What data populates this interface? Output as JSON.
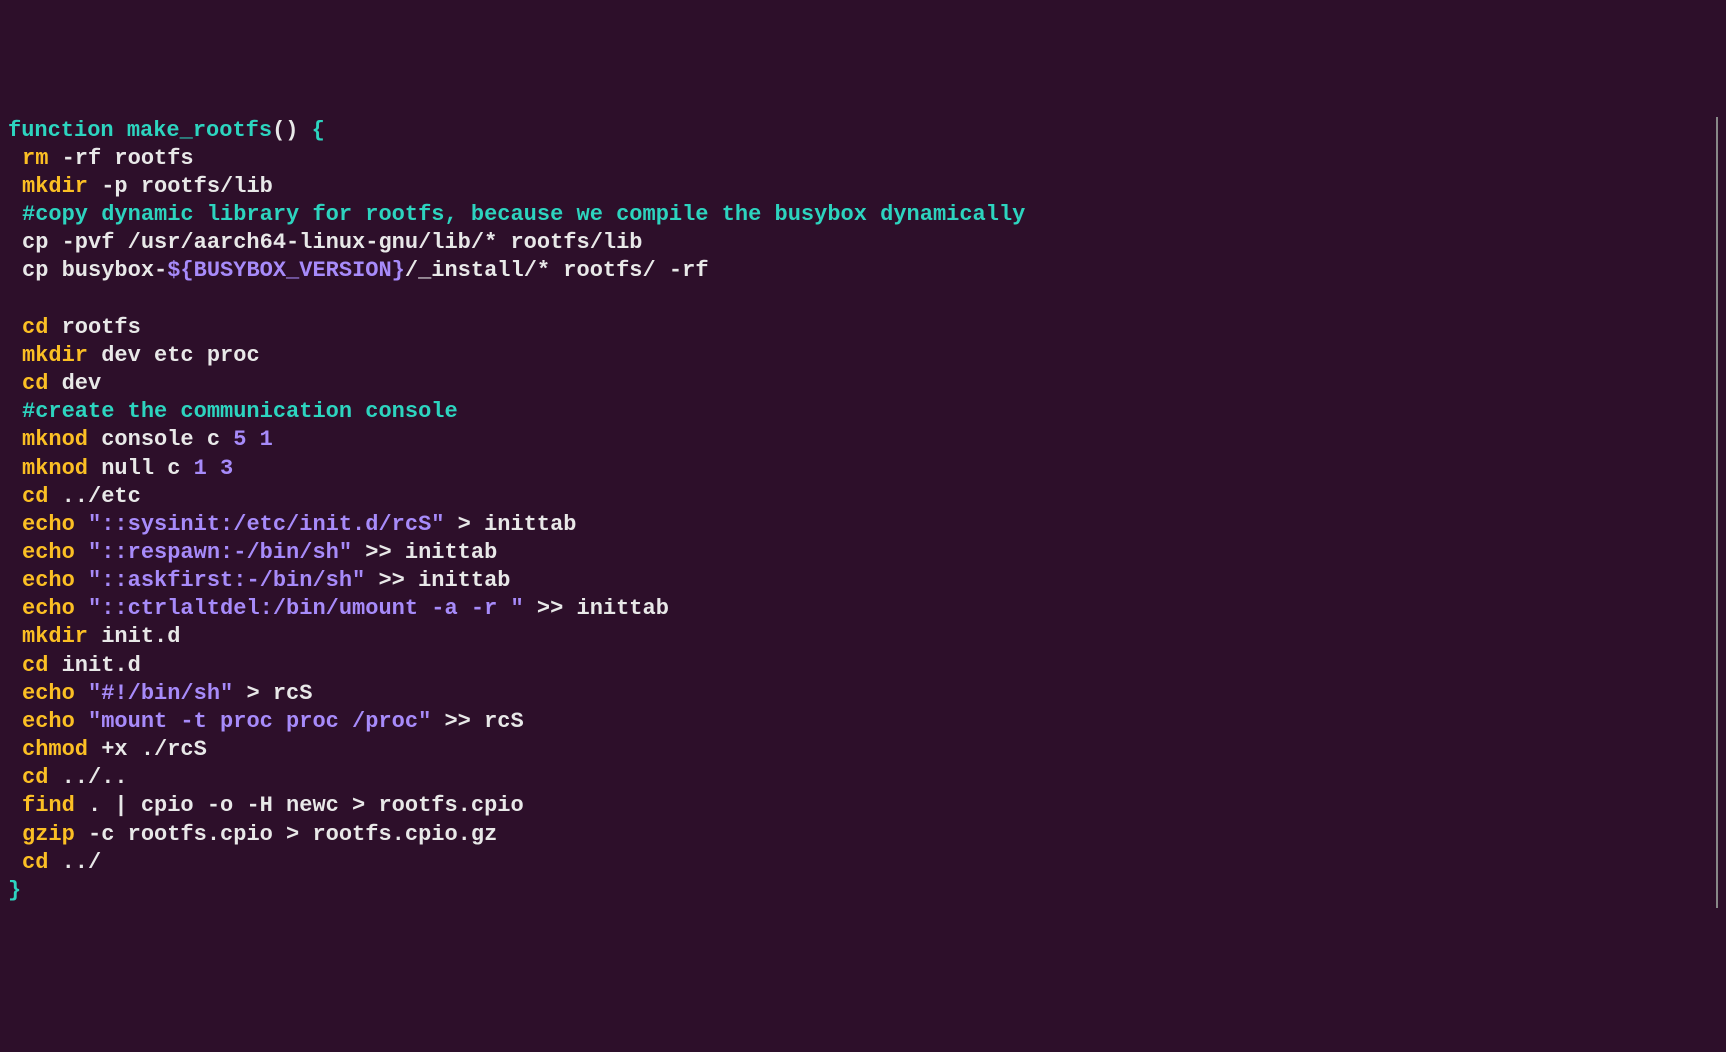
{
  "code": {
    "lines": [
      {
        "type": "funcdef",
        "indent": 0,
        "segments": [
          {
            "cls": "kw",
            "text": "function"
          },
          {
            "cls": "plain",
            "text": " "
          },
          {
            "cls": "func-name",
            "text": "make_rootfs"
          },
          {
            "cls": "paren",
            "text": "()"
          },
          {
            "cls": "plain",
            "text": " "
          },
          {
            "cls": "brace",
            "text": "{"
          }
        ]
      },
      {
        "type": "cmd",
        "indent": 1,
        "segments": [
          {
            "cls": "cmd",
            "text": "rm"
          },
          {
            "cls": "plain",
            "text": " -rf rootfs"
          }
        ]
      },
      {
        "type": "cmd",
        "indent": 1,
        "segments": [
          {
            "cls": "cmd",
            "text": "mkdir"
          },
          {
            "cls": "plain",
            "text": " -p rootfs/lib"
          }
        ]
      },
      {
        "type": "comment",
        "indent": 1,
        "segments": [
          {
            "cls": "comment",
            "text": "#copy dynamic library for rootfs, because we compile the busybox dynamically"
          }
        ]
      },
      {
        "type": "cmd",
        "indent": 1,
        "segments": [
          {
            "cls": "plain",
            "text": "cp -pvf /usr/aarch64-linux-gnu/lib/* rootfs/lib"
          }
        ]
      },
      {
        "type": "cmd",
        "indent": 1,
        "segments": [
          {
            "cls": "plain",
            "text": "cp busybox-"
          },
          {
            "cls": "var",
            "text": "${BUSYBOX_VERSION}"
          },
          {
            "cls": "plain",
            "text": "/_install/* rootfs/ -rf"
          }
        ]
      },
      {
        "type": "blank",
        "indent": 0,
        "segments": []
      },
      {
        "type": "cmd",
        "indent": 1,
        "segments": [
          {
            "cls": "cmd",
            "text": "cd"
          },
          {
            "cls": "plain",
            "text": " rootfs"
          }
        ]
      },
      {
        "type": "cmd",
        "indent": 1,
        "segments": [
          {
            "cls": "cmd",
            "text": "mkdir"
          },
          {
            "cls": "plain",
            "text": " dev etc proc"
          }
        ]
      },
      {
        "type": "cmd",
        "indent": 1,
        "segments": [
          {
            "cls": "cmd",
            "text": "cd"
          },
          {
            "cls": "plain",
            "text": " dev"
          }
        ]
      },
      {
        "type": "comment",
        "indent": 1,
        "segments": [
          {
            "cls": "comment",
            "text": "#create the communication console"
          }
        ]
      },
      {
        "type": "cmd",
        "indent": 1,
        "segments": [
          {
            "cls": "cmd",
            "text": "mknod"
          },
          {
            "cls": "plain",
            "text": " console c "
          },
          {
            "cls": "num",
            "text": "5 1"
          }
        ]
      },
      {
        "type": "cmd",
        "indent": 1,
        "segments": [
          {
            "cls": "cmd",
            "text": "mknod"
          },
          {
            "cls": "plain",
            "text": " null c "
          },
          {
            "cls": "num",
            "text": "1 3"
          }
        ]
      },
      {
        "type": "cmd",
        "indent": 1,
        "segments": [
          {
            "cls": "cmd",
            "text": "cd"
          },
          {
            "cls": "plain",
            "text": " ../etc"
          }
        ]
      },
      {
        "type": "cmd",
        "indent": 1,
        "segments": [
          {
            "cls": "cmd",
            "text": "echo"
          },
          {
            "cls": "plain",
            "text": " "
          },
          {
            "cls": "str",
            "text": "\"::sysinit:/etc/init.d/rcS\""
          },
          {
            "cls": "plain",
            "text": " > inittab"
          }
        ]
      },
      {
        "type": "cmd",
        "indent": 1,
        "segments": [
          {
            "cls": "cmd",
            "text": "echo"
          },
          {
            "cls": "plain",
            "text": " "
          },
          {
            "cls": "str",
            "text": "\"::respawn:-/bin/sh\""
          },
          {
            "cls": "plain",
            "text": " >> inittab"
          }
        ]
      },
      {
        "type": "cmd",
        "indent": 1,
        "segments": [
          {
            "cls": "cmd",
            "text": "echo"
          },
          {
            "cls": "plain",
            "text": " "
          },
          {
            "cls": "str",
            "text": "\"::askfirst:-/bin/sh\""
          },
          {
            "cls": "plain",
            "text": " >> inittab"
          }
        ]
      },
      {
        "type": "cmd",
        "indent": 1,
        "segments": [
          {
            "cls": "cmd",
            "text": "echo"
          },
          {
            "cls": "plain",
            "text": " "
          },
          {
            "cls": "str",
            "text": "\"::ctrlaltdel:/bin/umount -a -r \""
          },
          {
            "cls": "plain",
            "text": " >> inittab"
          }
        ]
      },
      {
        "type": "cmd",
        "indent": 1,
        "segments": [
          {
            "cls": "cmd",
            "text": "mkdir"
          },
          {
            "cls": "plain",
            "text": " init.d"
          }
        ]
      },
      {
        "type": "cmd",
        "indent": 1,
        "segments": [
          {
            "cls": "cmd",
            "text": "cd"
          },
          {
            "cls": "plain",
            "text": " init.d"
          }
        ]
      },
      {
        "type": "cmd",
        "indent": 1,
        "segments": [
          {
            "cls": "cmd",
            "text": "echo"
          },
          {
            "cls": "plain",
            "text": " "
          },
          {
            "cls": "str",
            "text": "\"#!/bin/sh\""
          },
          {
            "cls": "plain",
            "text": " > rcS"
          }
        ]
      },
      {
        "type": "cmd",
        "indent": 1,
        "segments": [
          {
            "cls": "cmd",
            "text": "echo"
          },
          {
            "cls": "plain",
            "text": " "
          },
          {
            "cls": "str",
            "text": "\"mount -t proc proc /proc\""
          },
          {
            "cls": "plain",
            "text": " >> rcS"
          }
        ]
      },
      {
        "type": "cmd",
        "indent": 1,
        "segments": [
          {
            "cls": "cmd",
            "text": "chmod"
          },
          {
            "cls": "plain",
            "text": " +x ./rcS"
          }
        ]
      },
      {
        "type": "cmd",
        "indent": 1,
        "segments": [
          {
            "cls": "cmd",
            "text": "cd"
          },
          {
            "cls": "plain",
            "text": " ../.."
          }
        ]
      },
      {
        "type": "cmd",
        "indent": 1,
        "segments": [
          {
            "cls": "cmd",
            "text": "find"
          },
          {
            "cls": "plain",
            "text": " . | cpio -o -H newc > rootfs.cpio"
          }
        ]
      },
      {
        "type": "cmd",
        "indent": 1,
        "segments": [
          {
            "cls": "cmd",
            "text": "gzip"
          },
          {
            "cls": "plain",
            "text": " -c rootfs.cpio > rootfs.cpio.gz"
          }
        ]
      },
      {
        "type": "cmd",
        "indent": 1,
        "segments": [
          {
            "cls": "cmd",
            "text": "cd"
          },
          {
            "cls": "plain",
            "text": " ../"
          }
        ]
      },
      {
        "type": "closebrace",
        "indent": 0,
        "segments": [
          {
            "cls": "brace",
            "text": "}"
          }
        ]
      }
    ]
  }
}
